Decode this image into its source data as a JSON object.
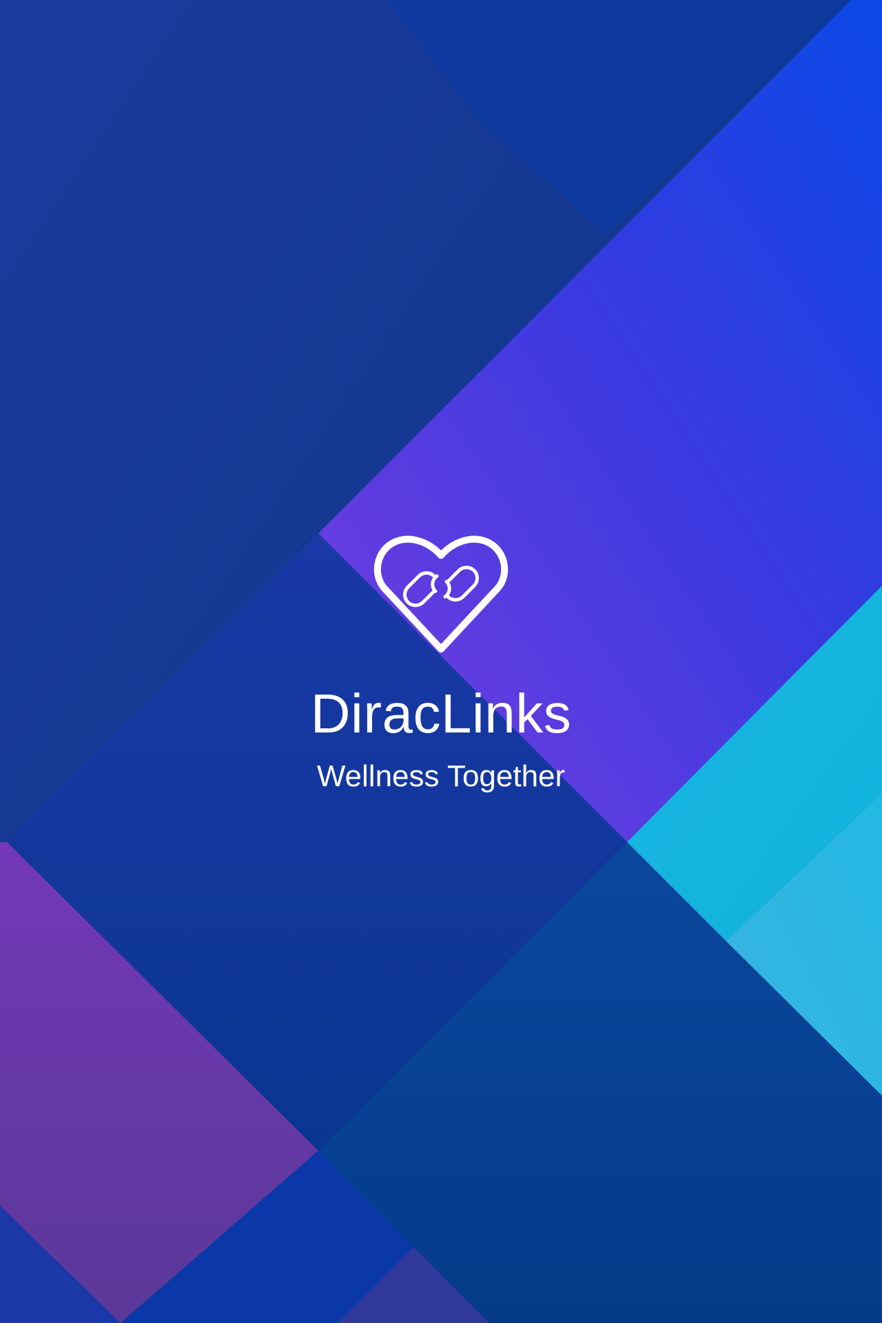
{
  "splash": {
    "app_name": "DiracLinks",
    "tagline": "Wellness Together",
    "logo_icon": "heart-with-chain-link-icon"
  },
  "colors": {
    "navy": "#0a3a8f",
    "royal_blue": "#0a44e0",
    "violet": "#7b3fe0",
    "purple": "#6a3aa8",
    "cyan": "#18b4e0",
    "logo_stroke": "#ffffff"
  }
}
